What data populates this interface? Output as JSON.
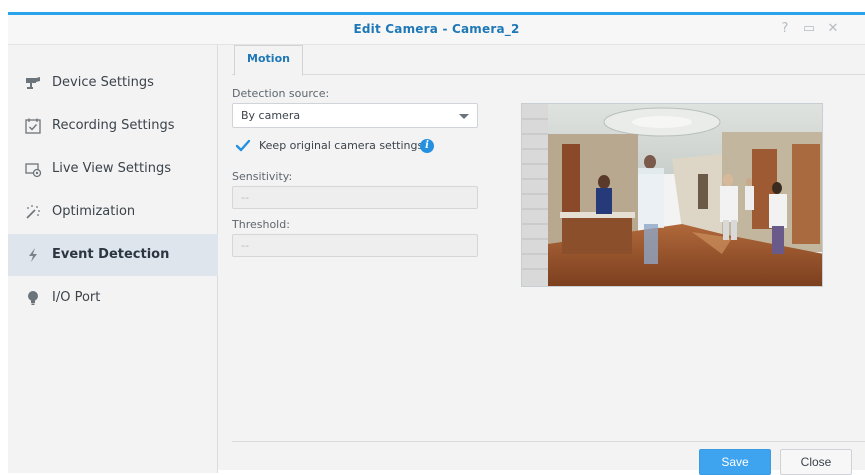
{
  "window": {
    "title": "Edit Camera - Camera_2",
    "help_glyph": "?",
    "maximize_glyph": "▭",
    "close_glyph": "✕"
  },
  "sidebar": {
    "items": [
      {
        "label": "Device Settings",
        "icon": "camera-icon",
        "active": false
      },
      {
        "label": "Recording Settings",
        "icon": "calendar-check-icon",
        "active": false
      },
      {
        "label": "Live View Settings",
        "icon": "live-view-icon",
        "active": false
      },
      {
        "label": "Optimization",
        "icon": "magic-wand-icon",
        "active": false
      },
      {
        "label": "Event Detection",
        "icon": "lightning-icon",
        "active": true
      },
      {
        "label": "I/O Port",
        "icon": "bulb-icon",
        "active": false
      }
    ]
  },
  "tabs": [
    {
      "label": "Motion",
      "active": true
    }
  ],
  "form": {
    "detection_source_label": "Detection source:",
    "detection_source_value": "By camera",
    "keep_original_label": "Keep original camera settings",
    "keep_original_checked": true,
    "sensitivity_label": "Sensitivity:",
    "sensitivity_value": "--",
    "threshold_label": "Threshold:",
    "threshold_value": "--"
  },
  "preview": {
    "description_icon": "camera-preview-image"
  },
  "footer": {
    "save_label": "Save",
    "close_label": "Close"
  },
  "colors": {
    "accent": "#2aa3ea",
    "title": "#1f78b6",
    "save_button": "#3fa4f0",
    "active_nav": "#dfe5ec"
  }
}
